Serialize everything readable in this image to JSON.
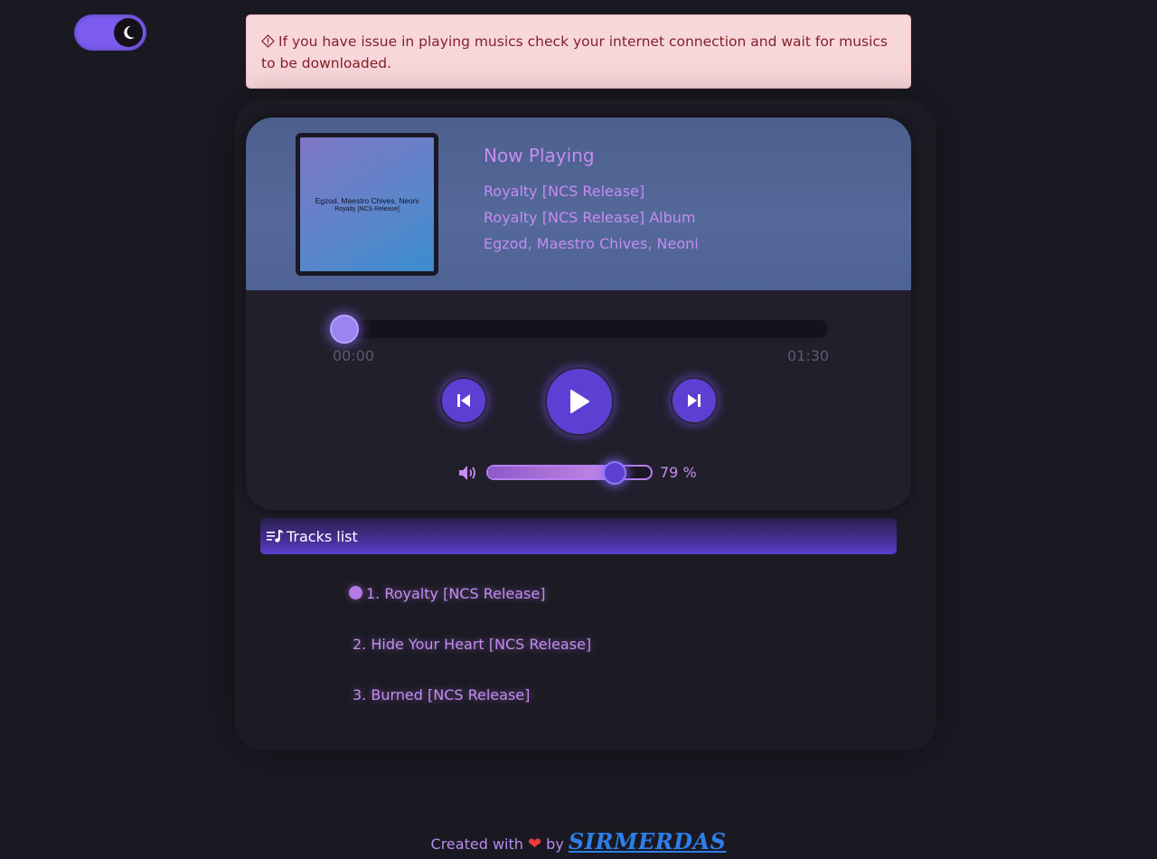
{
  "theme_toggle": {
    "icon": "moon-icon",
    "mode": "dark"
  },
  "alert": {
    "icon": "warning-diamond-icon",
    "text": "If you have issue in playing musics check your internet connection and wait for musics to be downloaded."
  },
  "player": {
    "cover": {
      "artist": "Egzod, Maestro Chives, Neoni",
      "title": "Royalty [NCS Release]"
    },
    "now_playing_label": "Now Playing",
    "track_title": "Royalty [NCS Release]",
    "album": "Royalty [NCS Release] Album",
    "artists": "Egzod, Maestro Chives, Neoni",
    "current_time": "00:00",
    "duration": "01:30",
    "progress": 0,
    "controls": {
      "prev_icon": "skip-previous-icon",
      "play_icon": "play-icon",
      "next_icon": "skip-next-icon"
    },
    "volume": {
      "icon": "volume-icon",
      "value": 79,
      "label": "79 %"
    }
  },
  "tracks": {
    "header": "Tracks list",
    "header_icon": "playlist-icon",
    "items": [
      {
        "label": "1. Royalty [NCS Release]",
        "active": true
      },
      {
        "label": "2. Hide Your Heart [NCS Release]",
        "active": false
      },
      {
        "label": "3. Burned [NCS Release]",
        "active": false
      }
    ]
  },
  "footer": {
    "prefix": "Created with",
    "heart": "❤",
    "by": "by",
    "author": "SIRMERDAS"
  },
  "colors": {
    "accent": "#5d3fd3",
    "text_accent": "#c58cf2",
    "background": "#1a1922",
    "alert_bg": "#f8d7da"
  }
}
